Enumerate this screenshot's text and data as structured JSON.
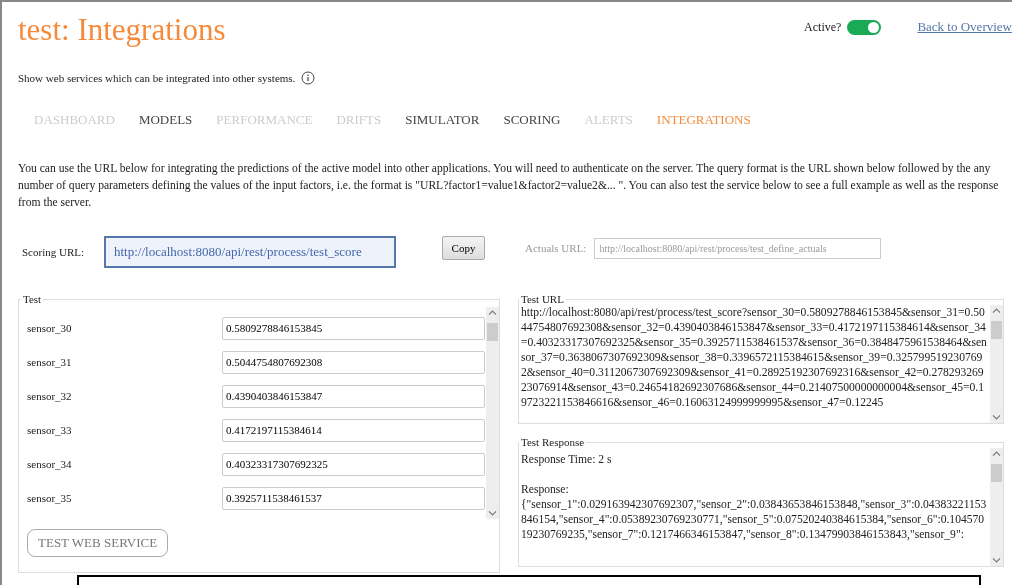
{
  "header": {
    "title": "test: Integrations",
    "active_label": "Active?",
    "active": {
      "on": true
    },
    "back_link": "Back to Overview"
  },
  "subtitle": "Show web services which can be integrated into other systems.",
  "tabs": [
    {
      "label": "DASHBOARD",
      "selected": false,
      "disabled": true
    },
    {
      "label": "MODELS",
      "selected": false,
      "disabled": false
    },
    {
      "label": "PERFORMANCE",
      "selected": false,
      "disabled": true
    },
    {
      "label": "DRIFTS",
      "selected": false,
      "disabled": true
    },
    {
      "label": "SIMULATOR",
      "selected": false,
      "disabled": false
    },
    {
      "label": "SCORING",
      "selected": false,
      "disabled": false
    },
    {
      "label": "ALERTS",
      "selected": false,
      "disabled": true
    },
    {
      "label": "INTEGRATIONS",
      "selected": true,
      "disabled": false
    }
  ],
  "description": "You can use the URL below for integrating the predictions of the active model into other applications. You will need to authenticate on the server. The query format is the URL shown below followed by the any number of query parameters defining the values of the input factors, i.e. the format is \"URL?factor1=value1&factor2=value2&... \". You can also test the service below to see a full example as well as the response from the server.",
  "scoring_url": {
    "label": "Scoring URL:",
    "value": "http://localhost:8080/api/rest/process/test_score",
    "copy_button": "Copy"
  },
  "actuals_url": {
    "label": "Actuals URL:",
    "value": "http://localhost:8080/api/rest/process/test_define_actuals",
    "disabled": true
  },
  "test": {
    "legend": "Test",
    "inputs": [
      {
        "name": "sensor_30",
        "value": "0.5809278846153845"
      },
      {
        "name": "sensor_31",
        "value": "0.5044754807692308"
      },
      {
        "name": "sensor_32",
        "value": "0.4390403846153847"
      },
      {
        "name": "sensor_33",
        "value": "0.4172197115384614"
      },
      {
        "name": "sensor_34",
        "value": "0.40323317307692325"
      },
      {
        "name": "sensor_35",
        "value": "0.3925711538461537"
      }
    ],
    "button": "TEST WEB SERVICE"
  },
  "test_url": {
    "legend": "Test URL",
    "value": "http://localhost:8080/api/rest/process/test_score?sensor_30=0.5809278846153845&sensor_31=0.5044754807692308&sensor_32=0.4390403846153847&sensor_33=0.4172197115384614&sensor_34=0.40323317307692325&sensor_35=0.3925711538461537&sensor_36=0.3848475961538464&sensor_37=0.3638067307692309&sensor_38=0.3396572115384615&sensor_39=0.3257995192307692&sensor_40=0.3112067307692309&sensor_41=0.28925192307692316&sensor_42=0.27829326923076914&sensor_43=0.24654182692307686&sensor_44=0.21407500000000004&sensor_45=0.19723221153846616&sensor_46=0.16063124999999995&sensor_47=0.12245"
  },
  "test_response": {
    "legend": "Test Response",
    "value": "Response Time: 2 s\n\nResponse:\n{\"sensor_1\":0.029163942307692307,\"sensor_2\":0.03843653846153848,\"sensor_3\":0.04383221153846154,\"sensor_4\":0.05389230769230771,\"sensor_5\":0.07520240384615384,\"sensor_6\":0.10457019230769235,\"sensor_7\":0.1217466346153847,\"sensor_8\":0.13479903846153843,\"sensor_9\":"
  }
}
